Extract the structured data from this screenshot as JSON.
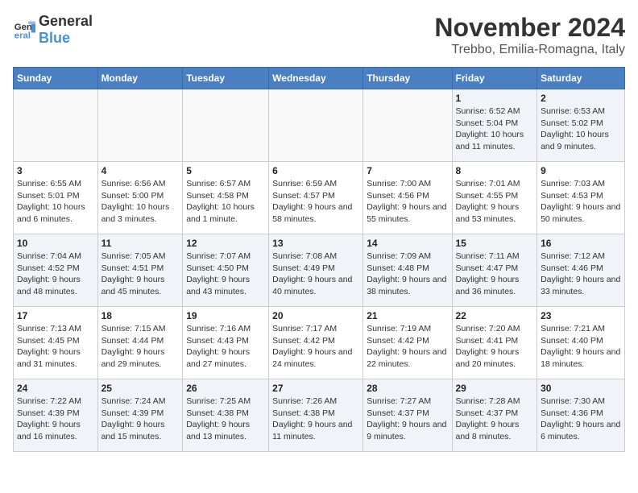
{
  "header": {
    "logo_general": "General",
    "logo_blue": "Blue",
    "month_year": "November 2024",
    "location": "Trebbo, Emilia-Romagna, Italy"
  },
  "weekdays": [
    "Sunday",
    "Monday",
    "Tuesday",
    "Wednesday",
    "Thursday",
    "Friday",
    "Saturday"
  ],
  "weeks": [
    [
      {
        "day": "",
        "info": "",
        "empty": true
      },
      {
        "day": "",
        "info": "",
        "empty": true
      },
      {
        "day": "",
        "info": "",
        "empty": true
      },
      {
        "day": "",
        "info": "",
        "empty": true
      },
      {
        "day": "",
        "info": "",
        "empty": true
      },
      {
        "day": "1",
        "info": "Sunrise: 6:52 AM\nSunset: 5:04 PM\nDaylight: 10 hours and 11 minutes.",
        "empty": false
      },
      {
        "day": "2",
        "info": "Sunrise: 6:53 AM\nSunset: 5:02 PM\nDaylight: 10 hours and 9 minutes.",
        "empty": false
      }
    ],
    [
      {
        "day": "3",
        "info": "Sunrise: 6:55 AM\nSunset: 5:01 PM\nDaylight: 10 hours and 6 minutes.",
        "empty": false
      },
      {
        "day": "4",
        "info": "Sunrise: 6:56 AM\nSunset: 5:00 PM\nDaylight: 10 hours and 3 minutes.",
        "empty": false
      },
      {
        "day": "5",
        "info": "Sunrise: 6:57 AM\nSunset: 4:58 PM\nDaylight: 10 hours and 1 minute.",
        "empty": false
      },
      {
        "day": "6",
        "info": "Sunrise: 6:59 AM\nSunset: 4:57 PM\nDaylight: 9 hours and 58 minutes.",
        "empty": false
      },
      {
        "day": "7",
        "info": "Sunrise: 7:00 AM\nSunset: 4:56 PM\nDaylight: 9 hours and 55 minutes.",
        "empty": false
      },
      {
        "day": "8",
        "info": "Sunrise: 7:01 AM\nSunset: 4:55 PM\nDaylight: 9 hours and 53 minutes.",
        "empty": false
      },
      {
        "day": "9",
        "info": "Sunrise: 7:03 AM\nSunset: 4:53 PM\nDaylight: 9 hours and 50 minutes.",
        "empty": false
      }
    ],
    [
      {
        "day": "10",
        "info": "Sunrise: 7:04 AM\nSunset: 4:52 PM\nDaylight: 9 hours and 48 minutes.",
        "empty": false
      },
      {
        "day": "11",
        "info": "Sunrise: 7:05 AM\nSunset: 4:51 PM\nDaylight: 9 hours and 45 minutes.",
        "empty": false
      },
      {
        "day": "12",
        "info": "Sunrise: 7:07 AM\nSunset: 4:50 PM\nDaylight: 9 hours and 43 minutes.",
        "empty": false
      },
      {
        "day": "13",
        "info": "Sunrise: 7:08 AM\nSunset: 4:49 PM\nDaylight: 9 hours and 40 minutes.",
        "empty": false
      },
      {
        "day": "14",
        "info": "Sunrise: 7:09 AM\nSunset: 4:48 PM\nDaylight: 9 hours and 38 minutes.",
        "empty": false
      },
      {
        "day": "15",
        "info": "Sunrise: 7:11 AM\nSunset: 4:47 PM\nDaylight: 9 hours and 36 minutes.",
        "empty": false
      },
      {
        "day": "16",
        "info": "Sunrise: 7:12 AM\nSunset: 4:46 PM\nDaylight: 9 hours and 33 minutes.",
        "empty": false
      }
    ],
    [
      {
        "day": "17",
        "info": "Sunrise: 7:13 AM\nSunset: 4:45 PM\nDaylight: 9 hours and 31 minutes.",
        "empty": false
      },
      {
        "day": "18",
        "info": "Sunrise: 7:15 AM\nSunset: 4:44 PM\nDaylight: 9 hours and 29 minutes.",
        "empty": false
      },
      {
        "day": "19",
        "info": "Sunrise: 7:16 AM\nSunset: 4:43 PM\nDaylight: 9 hours and 27 minutes.",
        "empty": false
      },
      {
        "day": "20",
        "info": "Sunrise: 7:17 AM\nSunset: 4:42 PM\nDaylight: 9 hours and 24 minutes.",
        "empty": false
      },
      {
        "day": "21",
        "info": "Sunrise: 7:19 AM\nSunset: 4:42 PM\nDaylight: 9 hours and 22 minutes.",
        "empty": false
      },
      {
        "day": "22",
        "info": "Sunrise: 7:20 AM\nSunset: 4:41 PM\nDaylight: 9 hours and 20 minutes.",
        "empty": false
      },
      {
        "day": "23",
        "info": "Sunrise: 7:21 AM\nSunset: 4:40 PM\nDaylight: 9 hours and 18 minutes.",
        "empty": false
      }
    ],
    [
      {
        "day": "24",
        "info": "Sunrise: 7:22 AM\nSunset: 4:39 PM\nDaylight: 9 hours and 16 minutes.",
        "empty": false
      },
      {
        "day": "25",
        "info": "Sunrise: 7:24 AM\nSunset: 4:39 PM\nDaylight: 9 hours and 15 minutes.",
        "empty": false
      },
      {
        "day": "26",
        "info": "Sunrise: 7:25 AM\nSunset: 4:38 PM\nDaylight: 9 hours and 13 minutes.",
        "empty": false
      },
      {
        "day": "27",
        "info": "Sunrise: 7:26 AM\nSunset: 4:38 PM\nDaylight: 9 hours and 11 minutes.",
        "empty": false
      },
      {
        "day": "28",
        "info": "Sunrise: 7:27 AM\nSunset: 4:37 PM\nDaylight: 9 hours and 9 minutes.",
        "empty": false
      },
      {
        "day": "29",
        "info": "Sunrise: 7:28 AM\nSunset: 4:37 PM\nDaylight: 9 hours and 8 minutes.",
        "empty": false
      },
      {
        "day": "30",
        "info": "Sunrise: 7:30 AM\nSunset: 4:36 PM\nDaylight: 9 hours and 6 minutes.",
        "empty": false
      }
    ]
  ]
}
